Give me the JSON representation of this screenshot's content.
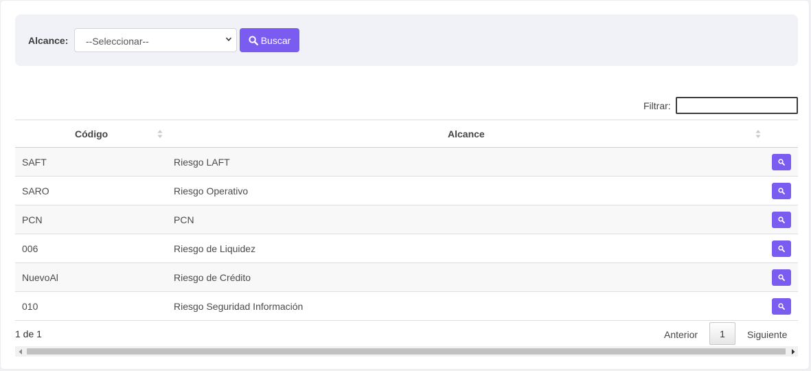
{
  "filter": {
    "label": "Alcance:",
    "select_value": "--Seleccionar--",
    "search_button": "Buscar"
  },
  "table_filter": {
    "label": "Filtrar:",
    "value": ""
  },
  "table": {
    "columns": [
      "Código",
      "Alcance"
    ],
    "rows": [
      {
        "codigo": "SAFT",
        "alcance": "Riesgo LAFT"
      },
      {
        "codigo": "SARO",
        "alcance": "Riesgo Operativo"
      },
      {
        "codigo": "PCN",
        "alcance": "PCN"
      },
      {
        "codigo": "006",
        "alcance": "Riesgo de Liquidez"
      },
      {
        "codigo": "NuevoAl",
        "alcance": "Riesgo de Crédito"
      },
      {
        "codigo": "010",
        "alcance": "Riesgo Seguridad Información"
      }
    ]
  },
  "pagination": {
    "info": "1 de 1",
    "previous": "Anterior",
    "current_page": "1",
    "next": "Siguiente"
  },
  "colors": {
    "accent": "#7b5cf0",
    "panel": "#f1f2f7"
  },
  "icons": {
    "search": "magnifier-icon",
    "sort": "sort-icon",
    "select": "chevron-down-icon"
  }
}
